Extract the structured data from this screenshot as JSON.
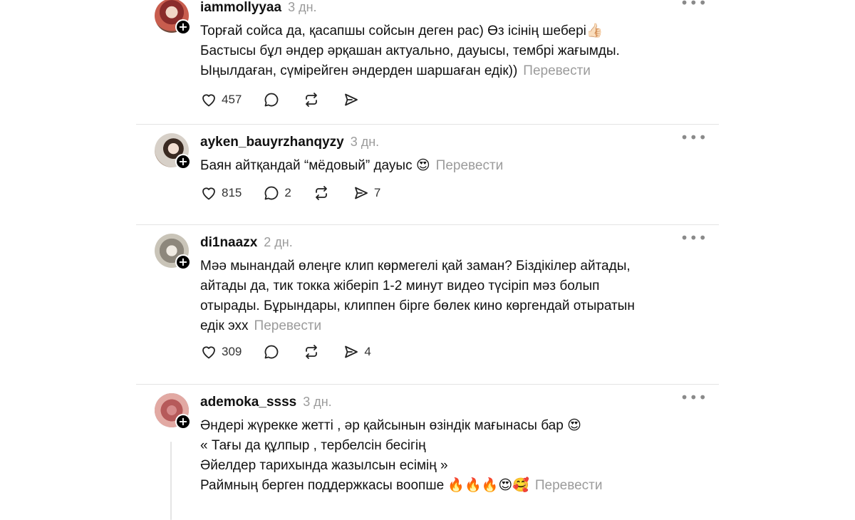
{
  "comments": [
    {
      "username": "iammollyyaa",
      "time": "3 дн.",
      "lines": [
        "Торғай сойса да, қасапшы сойсын деген рас) Өз ісінің шебері👍🏻",
        "Бастысы бұл әндер әрқашан актуально, дауысы, тембрі жағымды.",
        "Ыңылдаған, сүмірейген әндерден шаршаған едік))"
      ],
      "translate": "Перевести",
      "likes": "457",
      "replies": "",
      "reposts": "",
      "shares": ""
    },
    {
      "username": "ayken_bauyrzhanqyzy",
      "time": "3 дн.",
      "lines": [
        "Баян айтқандай “мёдовый” дауыс 😍"
      ],
      "translate": "Перевести",
      "likes": "815",
      "replies": "2",
      "reposts": "",
      "shares": "7"
    },
    {
      "username": "di1naazx",
      "time": "2 дн.",
      "lines": [
        "Мәә мынандай өлеңге клип көрмегелі қай заман? Біздікілер айтады,",
        "айтады да, тик токка жіберіп 1-2 минут видео түсіріп мәз болып",
        "отырады. Бұрындары, клиппен бірге бөлек кино көргендай отыратын",
        "едік эхх"
      ],
      "translate": "Перевести",
      "likes": "309",
      "replies": "",
      "reposts": "",
      "shares": "4"
    },
    {
      "username": "ademoka_ssss",
      "time": "3 дн.",
      "lines": [
        "Әндері жүрекке жетті , әр қайсынын өзіндік мағынасы бар 😍",
        "« Тағы да құлпыр , тербелсін бесігің",
        "Әйелдер тарихында жазылсын есімің »",
        "Раймның берген поддержкасы воопше 🔥🔥🔥😍🥰"
      ],
      "translate": "Перевести"
    }
  ],
  "icons": {
    "more": "more-dots-icon",
    "like": "heart-icon",
    "reply": "comment-bubble-icon",
    "repost": "repost-icon",
    "share": "send-icon",
    "follow": "plus-icon"
  }
}
